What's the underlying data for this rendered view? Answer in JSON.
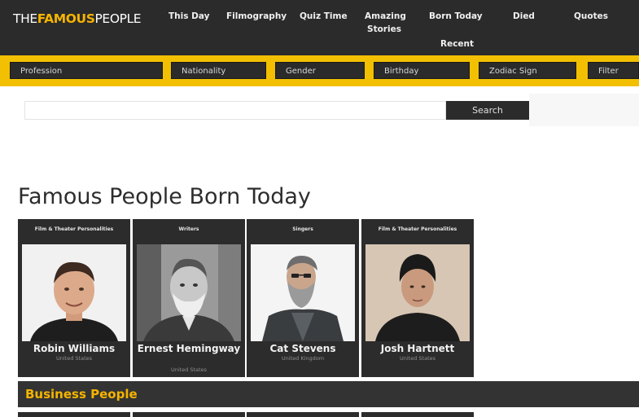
{
  "site": {
    "logo_part1": "THE",
    "logo_part2": "FAMOUS",
    "logo_part3": "PEOPLE"
  },
  "nav": {
    "this_day": "This Day",
    "filmography": "Filmography",
    "quiz_time": "Quiz Time",
    "amazing_stories": "Amazing Stories",
    "born_today": "Born Today",
    "died": "Died",
    "quotes": "Quotes",
    "recent": "Recent"
  },
  "filters": {
    "profession": "Profession",
    "nationality": "Nationality",
    "gender": "Gender",
    "birthday": "Birthday",
    "zodiac_sign": "Zodiac Sign",
    "filter": "Filter"
  },
  "search": {
    "value": "",
    "placeholder": "",
    "button_label": "Search"
  },
  "main": {
    "heading": "Famous People Born Today"
  },
  "cards": [
    {
      "category": "Film & Theater Personalities",
      "name": "Robin Williams",
      "country": "United States"
    },
    {
      "category": "Writers",
      "name": "Ernest Hemingway",
      "country": "United States"
    },
    {
      "category": "Singers",
      "name": "Cat Stevens",
      "country": "United Kingdom"
    },
    {
      "category": "Film & Theater Personalities",
      "name": "Josh Hartnett",
      "country": "United States"
    }
  ],
  "business": {
    "title": "Business People"
  },
  "colors": {
    "accent": "#f5b400",
    "dark": "#2b2b2b",
    "filter_bar": "#f2c000"
  }
}
